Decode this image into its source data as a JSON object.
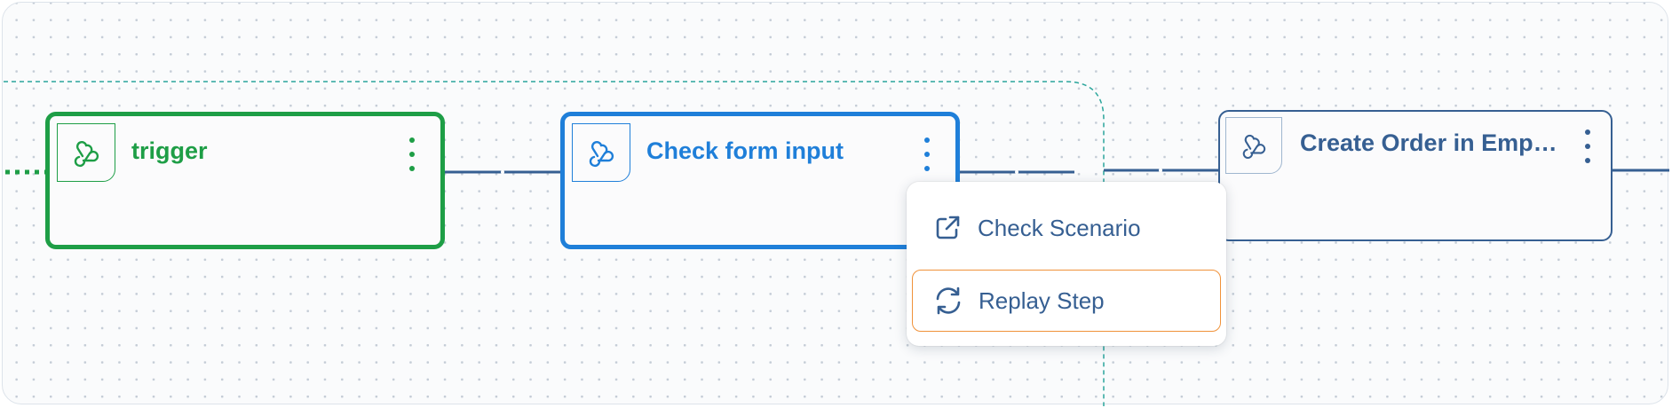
{
  "canvas": {
    "nodes": [
      {
        "title": "trigger",
        "icon": "webhook-icon",
        "color": "#1e9e46",
        "state": "success"
      },
      {
        "title": "Check form input",
        "icon": "webhook-icon",
        "color": "#1f7fd9",
        "state": "selected"
      },
      {
        "title": "Create Order in Empo...",
        "icon": "webhook-icon",
        "color": "#365f92",
        "state": "default"
      }
    ],
    "context_menu": {
      "items": [
        {
          "label": "Check Scenario",
          "icon": "external-link-icon"
        },
        {
          "label": "Replay Step",
          "icon": "refresh-icon",
          "highlighted": true
        }
      ]
    }
  },
  "colors": {
    "success": "#1e9e46",
    "active": "#1f7fd9",
    "default": "#365f92",
    "highlight_border": "#f0923a",
    "group_outline": "#2aa59b"
  }
}
